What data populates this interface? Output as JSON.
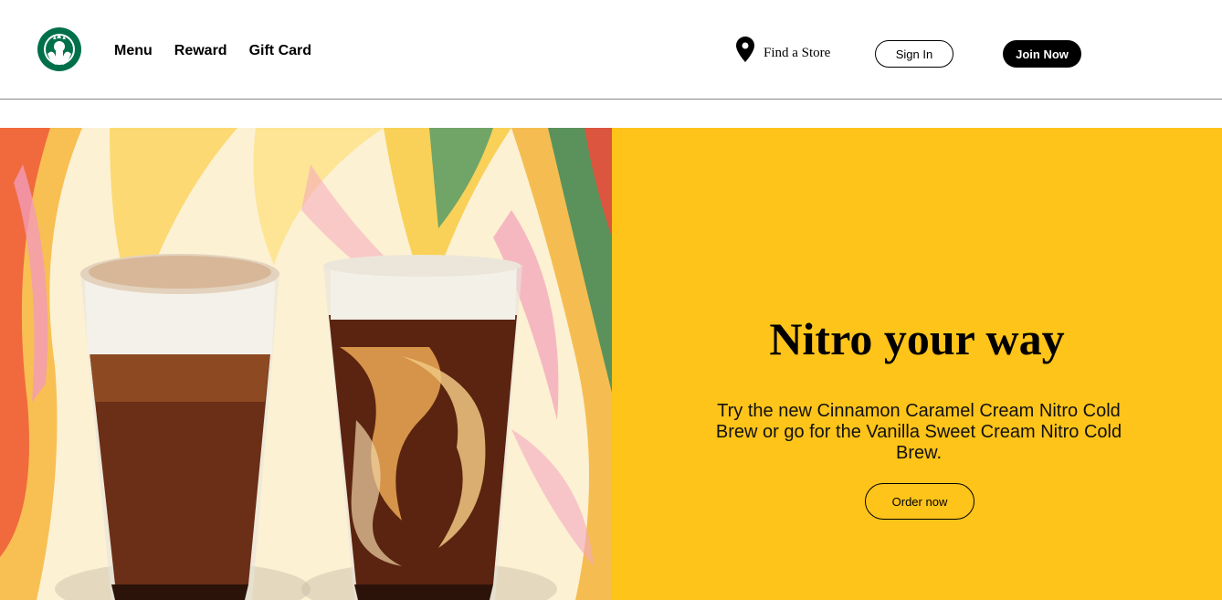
{
  "header": {
    "logo_alt": "Starbucks",
    "nav": [
      "Menu",
      "Reward",
      "Gift Card"
    ],
    "find_store": "Find a Store",
    "sign_in": "Sign In",
    "join_now": "Join Now"
  },
  "hero": {
    "image_description": "Two Starbucks nitro cold brew drinks",
    "title": "Nitro your way",
    "text": "Try the new Cinnamon Caramel Cream Nitro Cold Brew or go for the Vanilla Sweet Cream Nitro Cold Brew.",
    "cta": "Order now"
  },
  "colors": {
    "panel": "#fec419",
    "logo_green": "#00704a",
    "button_dark": "#000000"
  },
  "icons": {
    "logo": "starbucks-siren-logo",
    "location": "map-pin-icon"
  }
}
